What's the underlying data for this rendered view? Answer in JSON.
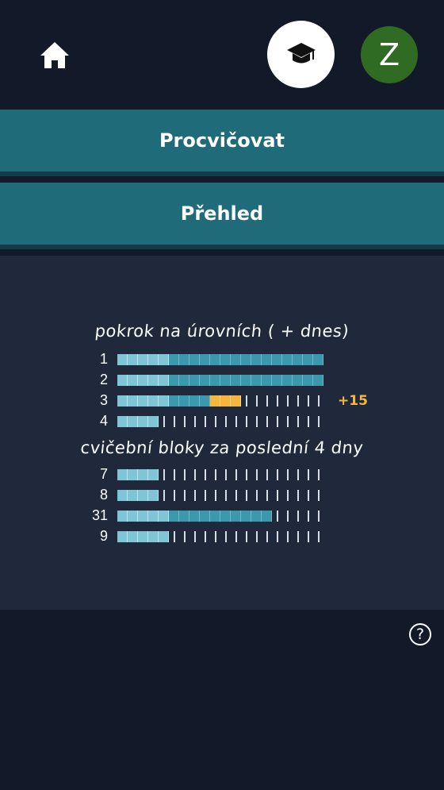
{
  "header": {
    "home_icon": "home-icon",
    "cap_icon": "graduation-cap-icon",
    "avatar_letter": "Z",
    "avatar_color": "#2f6b22"
  },
  "nav": {
    "practice_label": "Procvičovat",
    "overview_label": "Přehled"
  },
  "progress": {
    "title": "pokrok na úrovních ( + dnes)",
    "rows": [
      {
        "label": "1",
        "filled": 20,
        "today": 0,
        "total": 20
      },
      {
        "label": "2",
        "filled": 20,
        "today": 0,
        "total": 20
      },
      {
        "label": "3",
        "filled": 9,
        "today": 3,
        "total": 20,
        "today_text": "+15"
      },
      {
        "label": "4",
        "filled": 4,
        "today": 0,
        "total": 20
      }
    ]
  },
  "blocks": {
    "title": "cvičební bloky za poslední 4 dny",
    "rows": [
      {
        "label": "7",
        "filled": 4,
        "total": 20
      },
      {
        "label": "8",
        "filled": 4,
        "total": 20
      },
      {
        "label": "31",
        "filled": 15,
        "total": 20
      },
      {
        "label": "9",
        "filled": 5,
        "total": 20
      }
    ]
  },
  "help_label": "?",
  "colors": {
    "background": "#121a2a",
    "nav_button": "#1f6b7a",
    "panel": "#1f293b",
    "bar_light": "#7ec6d6",
    "bar_mid": "#3c98ad",
    "today": "#f4b63f"
  }
}
